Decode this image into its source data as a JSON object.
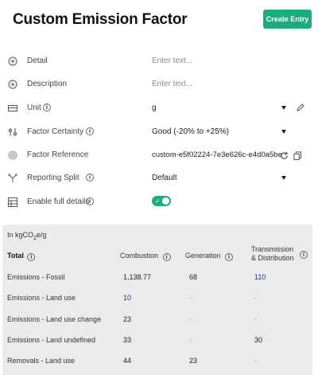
{
  "header": {
    "title": "Custom Emission Factor",
    "create_button": "Create Entry"
  },
  "form": {
    "detail": {
      "label": "Detail",
      "placeholder": "Enter text..."
    },
    "description": {
      "label": "Description",
      "placeholder": "Enter text..."
    },
    "unit": {
      "label": "Unit",
      "value": "g"
    },
    "factor_certainty": {
      "label": "Factor Certainty",
      "value": "Good (-20% to +25%)"
    },
    "factor_reference": {
      "label": "Factor Reference",
      "value": "custom-e5f02224-7e3e626c-e4d0a5be"
    },
    "reporting_split": {
      "label": "Reporting Split",
      "value": "Default"
    },
    "enable_full_details": {
      "label": "Enable full details",
      "value": true
    }
  },
  "results": {
    "unit_prefix": "In kgCO",
    "unit_sub": "2",
    "unit_suffix": "e/g",
    "columns": {
      "total": "Total",
      "combustion": "Combustion",
      "generation": "Generation",
      "transmission_line1": "Transmission",
      "transmission_line2": "& Distribution"
    },
    "rows": [
      {
        "label": "Emissions - Fossil",
        "combustion": "1,138.77",
        "generation": "68",
        "transmission": "110"
      },
      {
        "label": "Emissions - Land use",
        "combustion": "10",
        "generation": "-",
        "transmission": "-"
      },
      {
        "label": "Emissions - Land use change",
        "combustion": "23",
        "generation": "-",
        "transmission": "-"
      },
      {
        "label": "Emissions - Land undefined",
        "combustion": "33",
        "generation": "-",
        "transmission": "30"
      },
      {
        "label": "Removals - Land use",
        "combustion": "44",
        "generation": "23",
        "transmission": "-"
      }
    ]
  },
  "colors": {
    "accent": "#1bae7a",
    "results_bg": "#ebebeb",
    "link_blue": "#1a3a8a"
  }
}
